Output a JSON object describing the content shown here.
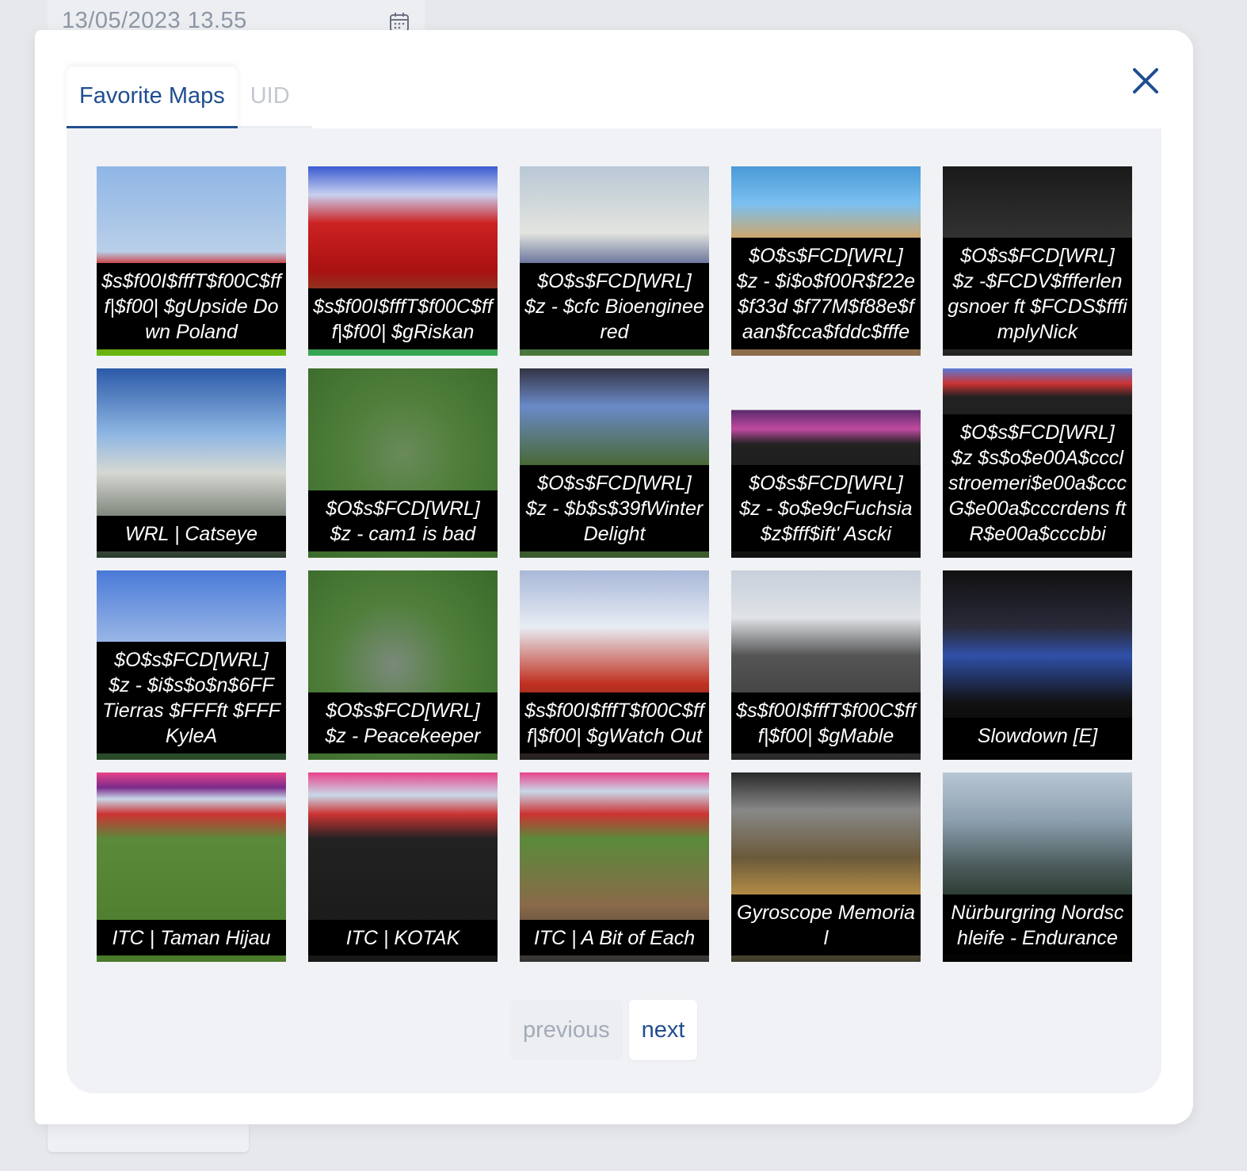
{
  "background": {
    "datetime": "13/05/2023 13.55"
  },
  "tabs": [
    {
      "label": "Favorite Maps",
      "active": true
    },
    {
      "label": "UID",
      "active": false
    }
  ],
  "maps": [
    {
      "name": "$s$f00I$fffT$f00C$fff|$f00| $gUpside Down Poland",
      "thumb": "t-tower"
    },
    {
      "name": "$s$f00I$fffT$f00C$fff|$f00| $gRiskan",
      "thumb": "t-red"
    },
    {
      "name": "$O$s$FCD[WRL] $z - $cfc Bioengineered",
      "thumb": "t-stadium"
    },
    {
      "name": "$O$s$FCD[WRL] $z - $i$o$f00R$f22e$f33d $f77M$f88e$faan$fcca$fddc$fffe",
      "thumb": "t-desert"
    },
    {
      "name": "$O$s$FCD[WRL] $z -$FCDV$ffferlengsnoer ft $FCDS$fffimplyNick",
      "thumb": "t-dark"
    },
    {
      "name": "WRL | Catseye",
      "thumb": "t-catseye"
    },
    {
      "name": "$O$s$FCD[WRL] $z - cam1 is bad",
      "thumb": "t-green"
    },
    {
      "name": "$O$s$FCD[WRL] $z - $b$s$39fWinter Delight",
      "thumb": "t-winter"
    },
    {
      "name": "$O$s$FCD[WRL] $z - $o$e9cFuchsia $z$fff$ift' Ascki",
      "thumb": "t-fuchsia"
    },
    {
      "name": "$O$s$FCD[WRL] $z $s$o$e00A$ccclstroemeri$e00a$ccc G$e00a$cccrdens ft R$e00a$cccbbi",
      "thumb": "t-redtop"
    },
    {
      "name": "$O$s$FCD[WRL] $z - $i$s$o$n$6FF Tierras $FFFft $FFFKyleA",
      "thumb": "t-sky"
    },
    {
      "name": "$O$s$FCD[WRL] $z - Peacekeeper",
      "thumb": "t-green2"
    },
    {
      "name": "$s$f00I$fffT$f00C$fff|$f00| $gWatch Out",
      "thumb": "t-roof"
    },
    {
      "name": "$s$f00I$fffT$f00C$fff|$f00| $gMable",
      "thumb": "t-arch"
    },
    {
      "name": "Slowdown [E]",
      "thumb": "t-worldtour"
    },
    {
      "name": "ITC | Taman Hijau",
      "thumb": "t-itc1"
    },
    {
      "name": "ITC | KOTAK",
      "thumb": "t-itc2"
    },
    {
      "name": "ITC | A Bit of Each",
      "thumb": "t-itc3"
    },
    {
      "name": "Gyroscope Memorial",
      "thumb": "t-gyro"
    },
    {
      "name": "Nürburgring Nordschleife - Endurance",
      "thumb": "t-nurburg"
    }
  ],
  "pagination": {
    "previous_label": "previous",
    "next_label": "next"
  },
  "icons": {
    "close": "close-icon",
    "calendar": "calendar-icon"
  },
  "colors": {
    "accent": "#1f4e8f",
    "panel": "#f1f2f5",
    "inactive_text": "#c3c8d0"
  }
}
